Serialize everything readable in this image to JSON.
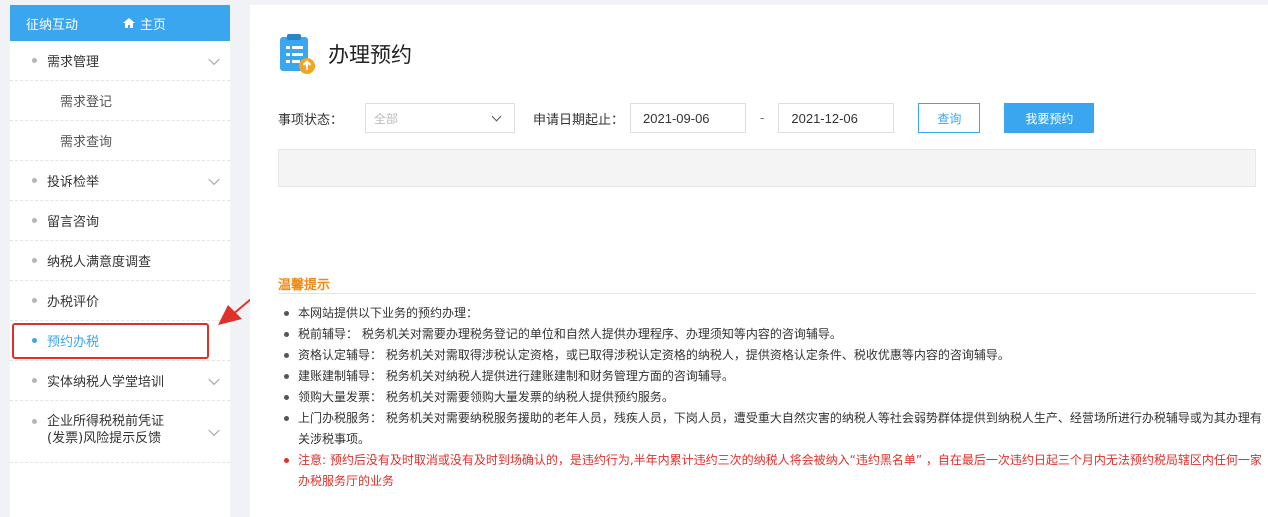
{
  "sidebar": {
    "header": {
      "title": "征纳互动",
      "home_label": "主页"
    },
    "items": [
      {
        "label": "需求管理"
      },
      {
        "label": "需求登记"
      },
      {
        "label": "需求查询"
      },
      {
        "label": "投诉检举"
      },
      {
        "label": "留言咨询"
      },
      {
        "label": "纳税人满意度调查"
      },
      {
        "label": "办税评价"
      },
      {
        "label": "预约办税"
      },
      {
        "label": "实体纳税人学堂培训"
      },
      {
        "label": "企业所得税税前凭证(发票)风险提示反馈"
      }
    ]
  },
  "main": {
    "title": "办理预约",
    "filter": {
      "status_label": "事项状态：",
      "status_value": "全部",
      "date_label": "申请日期起止：",
      "date_start": "2021-09-06",
      "date_sep": "-",
      "date_end": "2021-12-06",
      "query_button": "查询",
      "book_button": "我要预约"
    },
    "tips": {
      "title": "温馨提示",
      "items": [
        "本网站提供以下业务的预约办理：",
        "税前辅导： 税务机关对需要办理税务登记的单位和自然人提供办理程序、办理须知等内容的咨询辅导。",
        "资格认定辅导： 税务机关对需取得涉税认定资格，或已取得涉税认定资格的纳税人，提供资格认定条件、税收优惠等内容的咨询辅导。",
        "建账建制辅导： 税务机关对纳税人提供进行建账建制和财务管理方面的咨询辅导。",
        "领购大量发票： 税务机关对需要领购大量发票的纳税人提供预约服务。",
        "上门办税服务： 税务机关对需要纳税服务援助的老年人员，残疾人员，下岗人员，遭受重大自然灾害的纳税人等社会弱势群体提供到纳税人生产、经营场所进行办税辅导或为其办理有关涉税事项。",
        "注意: 预约后没有及时取消或没有及时到场确认的，是违约行为,半年内累计违约三次的纳税人将会被纳入“违约黑名单” ，自在最后一次违约日起三个月内无法预约税局辖区内任何一家办税服务厅的业务"
      ]
    }
  },
  "colors": {
    "accent": "#3aa6f0",
    "warning": "#e0302a",
    "tip_title": "#f08a17"
  },
  "icons": {
    "home": "home-icon",
    "page": "clipboard-upload-icon",
    "dropdown": "chevron-down-icon"
  }
}
